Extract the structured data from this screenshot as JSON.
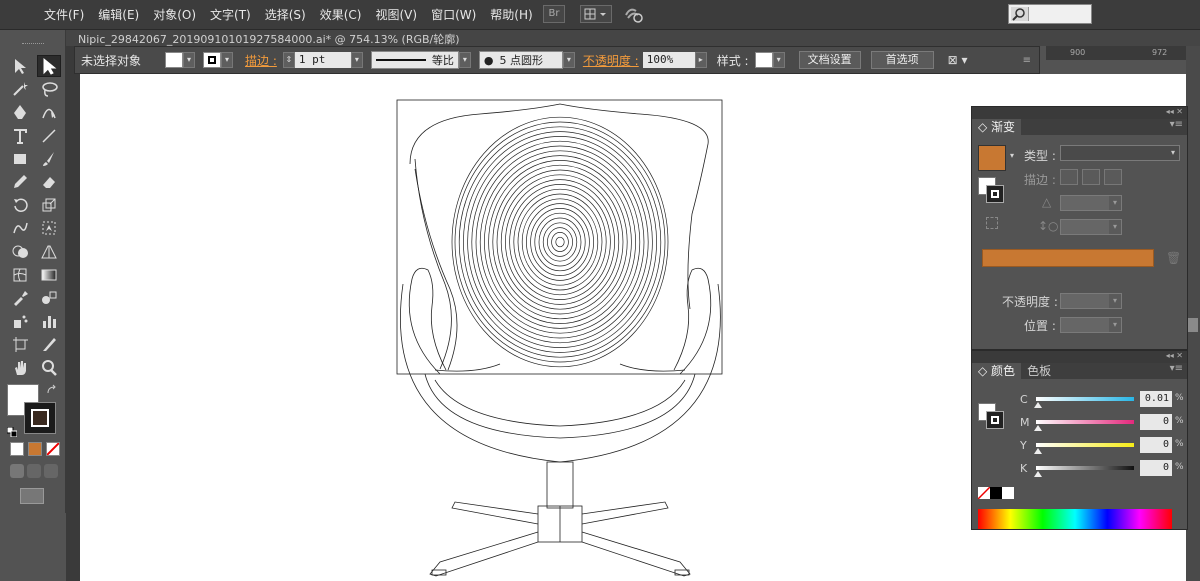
{
  "menu": [
    "文件(F)",
    "编辑(E)",
    "对象(O)",
    "文字(T)",
    "选择(S)",
    "效果(C)",
    "视图(V)",
    "窗口(W)",
    "帮助(H)"
  ],
  "menubar": {
    "br_label": "Br"
  },
  "doc": {
    "tab_title": "Nipic_29842067_20190910101927584000.ai* @ 754.13% (RGB/轮廓)"
  },
  "ruler": {
    "mark1": "900",
    "mark2": "972"
  },
  "control": {
    "selection_label": "未选择对象",
    "stroke_label": "描边 :",
    "stroke_weight": "1 pt",
    "profile_label": "等比",
    "brush_label": "5 点圆形",
    "opacity_label": "不透明度 :",
    "opacity_value": "100%",
    "style_label": "样式 :",
    "doc_setup": "文档设置",
    "preferences": "首选项"
  },
  "tools": [
    "selection-tool",
    "direct-selection-tool",
    "magic-wand-tool",
    "lasso-tool",
    "pen-tool",
    "curvature-tool",
    "type-tool",
    "line-tool",
    "rectangle-tool",
    "paintbrush-tool",
    "pencil-tool",
    "eraser-tool",
    "rotate-tool",
    "scale-tool",
    "warp-tool",
    "free-transform-tool",
    "shape-builder-tool",
    "perspective-tool",
    "mesh-tool",
    "gradient-tool",
    "eyedropper-tool",
    "blend-tool",
    "symbol-sprayer-tool",
    "column-graph-tool",
    "artboard-tool",
    "slice-tool",
    "hand-tool",
    "zoom-tool"
  ],
  "colors": {
    "fill": "#ffffff",
    "stroke": "#1b1b1b",
    "accent_orange": "#c87832"
  },
  "gradient_panel": {
    "tab": "渐变",
    "type_label": "类型 :",
    "stroke_label": "描边 :",
    "opacity_label": "不透明度 :",
    "location_label": "位置 :",
    "bar_color": "#c87832"
  },
  "color_panel": {
    "tab_color": "颜色",
    "tab_swatches": "色板",
    "channels": [
      {
        "name": "C",
        "value": "0.01",
        "gradient": "linear-gradient(to right,#fff,#29b6e6)"
      },
      {
        "name": "M",
        "value": "0",
        "gradient": "linear-gradient(to right,#fff,#e4287c)"
      },
      {
        "name": "Y",
        "value": "0",
        "gradient": "linear-gradient(to right,#fff,#f6ec17)"
      },
      {
        "name": "K",
        "value": "0",
        "gradient": "linear-gradient(to right,#fff,#111)"
      }
    ],
    "percent": "%"
  }
}
